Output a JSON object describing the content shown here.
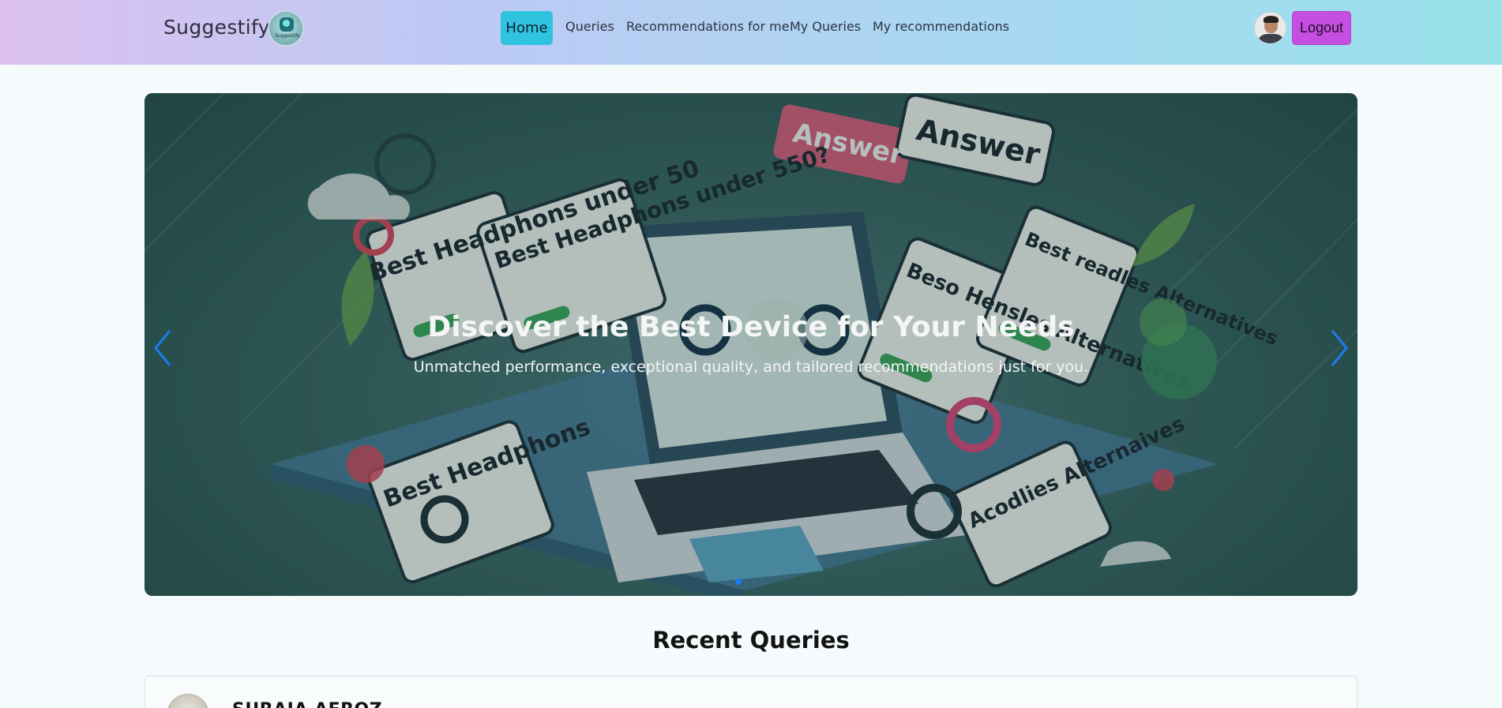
{
  "navbar": {
    "brand": "Suggestify",
    "logo_text": "Suggestify",
    "links": {
      "home": "Home",
      "queries": "Queries",
      "recommendations_for_me": "Recommendations for me",
      "my_queries": "My Queries",
      "my_recommendations": "My recommendations"
    },
    "logout": "Logout"
  },
  "hero": {
    "title": "Discover the Best Device for Your Needs",
    "subtitle": "Unmatched performance, exceptional quality, and tailored recommendations just for you.",
    "art_labels": {
      "a": "Best Headphons under 50",
      "b": "Best Headphons under 550?",
      "c": "Answer",
      "d": "Answer",
      "e": "Beso Hensles Alternatives",
      "f": "Best readles Alternatives",
      "g": "Best Headphons",
      "h": "Acodlies Alternaives"
    },
    "active_slide": 1
  },
  "recent": {
    "title": "Recent Queries",
    "first_card_name": "SURAIA AFROZ"
  },
  "colors": {
    "home_button": "#2fc3e0",
    "logout_button": "#c44fe0",
    "carousel_arrows": "#1a7cf0"
  },
  "icons": {
    "prev": "chevron-left-icon",
    "next": "chevron-right-icon"
  }
}
